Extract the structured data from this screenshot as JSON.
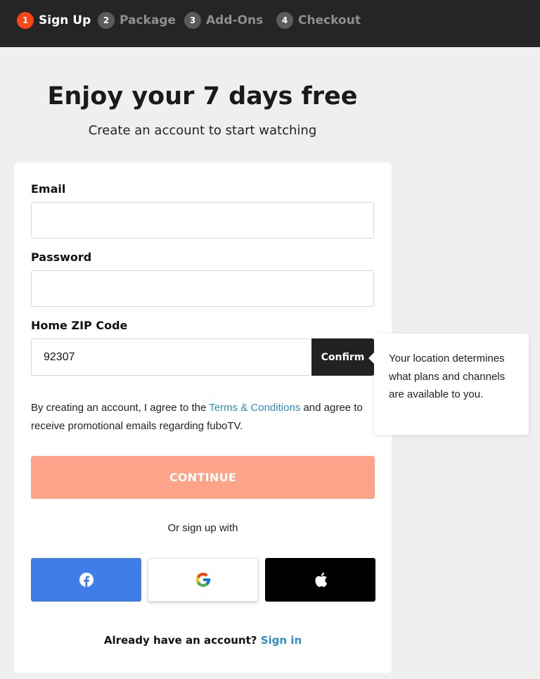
{
  "steps": [
    {
      "number": "1",
      "label": "Sign Up",
      "active": true
    },
    {
      "number": "2",
      "label": "Package",
      "active": false
    },
    {
      "number": "3",
      "label": "Add-Ons",
      "active": false
    },
    {
      "number": "4",
      "label": "Checkout",
      "active": false
    }
  ],
  "hero": {
    "title": "Enjoy your 7 days free",
    "subtitle": "Create an account to start watching"
  },
  "form": {
    "email_label": "Email",
    "email_value": "",
    "password_label": "Password",
    "password_value": "",
    "zip_label": "Home ZIP Code",
    "zip_value": "92307",
    "confirm_label": "Confirm"
  },
  "terms": {
    "prefix": "By creating an account, I agree to the ",
    "link": "Terms & Conditions",
    "suffix": " and agree to receive promotional emails regarding fuboTV."
  },
  "continue_label": "CONTINUE",
  "alt_signup_text": "Or sign up with",
  "social": [
    {
      "provider": "facebook",
      "icon": "facebook-icon",
      "color": "#3f7ee8"
    },
    {
      "provider": "google",
      "icon": "google-icon",
      "color": "#ffffff"
    },
    {
      "provider": "apple",
      "icon": "apple-icon",
      "color": "#000000"
    }
  ],
  "signin": {
    "prompt": "Already have an account?",
    "link": "Sign in"
  },
  "tooltip": {
    "text": "Your location determines what plans and channels are available to you."
  },
  "colors": {
    "accent": "#fa4616",
    "continue_bg": "#fca38a",
    "link": "#2d8fc6",
    "topbar": "#252525"
  }
}
